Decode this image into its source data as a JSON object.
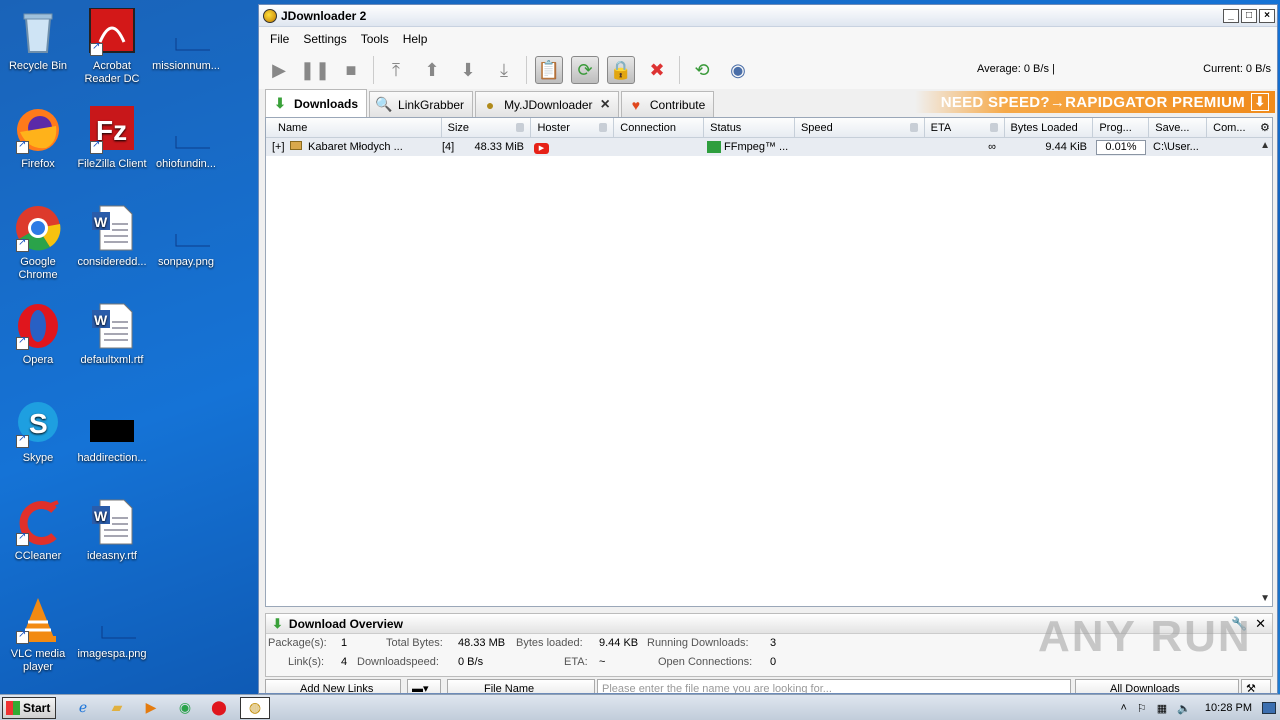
{
  "desktop": {
    "icons": [
      {
        "label": "Recycle Bin"
      },
      {
        "label": "Acrobat Reader DC"
      },
      {
        "label": "missionnum..."
      },
      {
        "label": "Firefox"
      },
      {
        "label": "FileZilla Client"
      },
      {
        "label": "ohiofundin..."
      },
      {
        "label": "Google Chrome"
      },
      {
        "label": "consideredd..."
      },
      {
        "label": "sonpay.png"
      },
      {
        "label": "Opera"
      },
      {
        "label": "defaultxml.rtf"
      },
      {
        "label": "Skype"
      },
      {
        "label": "haddirection..."
      },
      {
        "label": "CCleaner"
      },
      {
        "label": "ideasny.rtf"
      },
      {
        "label": "VLC media player"
      },
      {
        "label": "imagespa.png"
      }
    ]
  },
  "window": {
    "title": "JDownloader 2",
    "menu": [
      "File",
      "Settings",
      "Tools",
      "Help"
    ],
    "speed_average": "Average: 0 B/s |",
    "speed_current": "Current: 0 B/s",
    "tabs": [
      {
        "label": "Downloads"
      },
      {
        "label": "LinkGrabber"
      },
      {
        "label": "My.JDownloader"
      },
      {
        "label": "Contribute"
      }
    ],
    "promo": "NEED SPEED?→RAPIDGATOR PREMIUM",
    "columns": [
      "Name",
      "Size",
      "Hoster",
      "Connection",
      "Status",
      "Speed",
      "ETA",
      "Bytes Loaded",
      "Prog...",
      "Save...",
      "Com..."
    ],
    "rows": [
      {
        "expander": "[+]",
        "name": "Kabaret Młodych ...",
        "count": "[4]",
        "size": "48.33 MiB",
        "status": "FFmpeg™ ...",
        "eta": "∞",
        "bytes_loaded": "9.44 KiB",
        "progress": "0.01%",
        "save_to": "C:\\User..."
      }
    ],
    "overview": {
      "title": "Download Overview",
      "packages_label": "Package(s):",
      "packages": "1",
      "total_bytes_label": "Total Bytes:",
      "total_bytes": "48.33 MB",
      "bytes_loaded_label": "Bytes loaded:",
      "bytes_loaded": "9.44 KB",
      "running_label": "Running Downloads:",
      "running": "3",
      "links_label": "Link(s):",
      "links": "4",
      "speed_label": "Downloadspeed:",
      "speed": "0 B/s",
      "eta_label": "ETA:",
      "eta": "~",
      "open_conn_label": "Open Connections:",
      "open_conn": "0"
    },
    "bottom": {
      "add_links": "Add New Links",
      "file_name": "File Name",
      "search_placeholder": "Please enter the file name you are looking for...",
      "all_downloads": "All Downloads"
    }
  },
  "watermark": "ANY RUN",
  "taskbar": {
    "start": "Start",
    "time": "10:28 PM"
  }
}
